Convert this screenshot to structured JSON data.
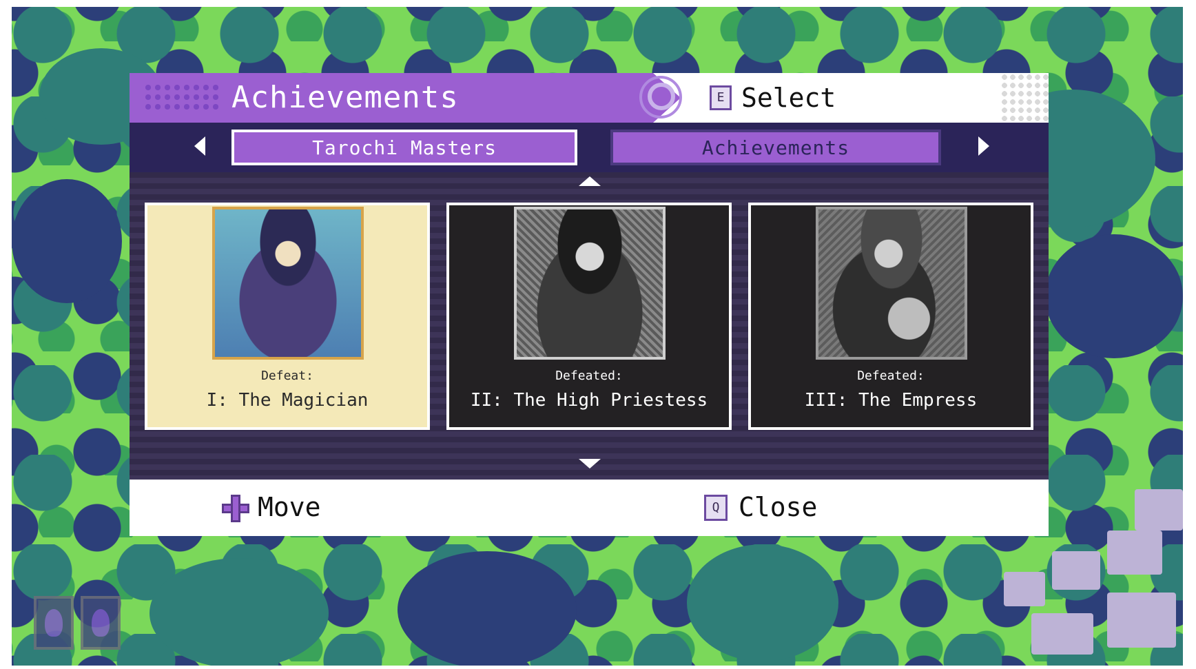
{
  "header": {
    "title": "Achievements",
    "select_key": "E",
    "select_label": "Select"
  },
  "tabs": [
    {
      "label": "Tarochi Masters",
      "active": true
    },
    {
      "label": "Achievements",
      "active": false
    }
  ],
  "cards": [
    {
      "status": "Defeat:",
      "name": "I: The Magician",
      "selected": true
    },
    {
      "status": "Defeated:",
      "name": "II: The High Priestess",
      "selected": false
    },
    {
      "status": "Defeated:",
      "name": "III: The Empress",
      "selected": false
    }
  ],
  "footer": {
    "move_label": "Move",
    "close_key": "Q",
    "close_label": "Close"
  },
  "colors": {
    "accent_purple": "#9b5fd1",
    "navy": "#2b2459",
    "selected_card": "#f4e9b8",
    "grass": "#7bd85a"
  }
}
